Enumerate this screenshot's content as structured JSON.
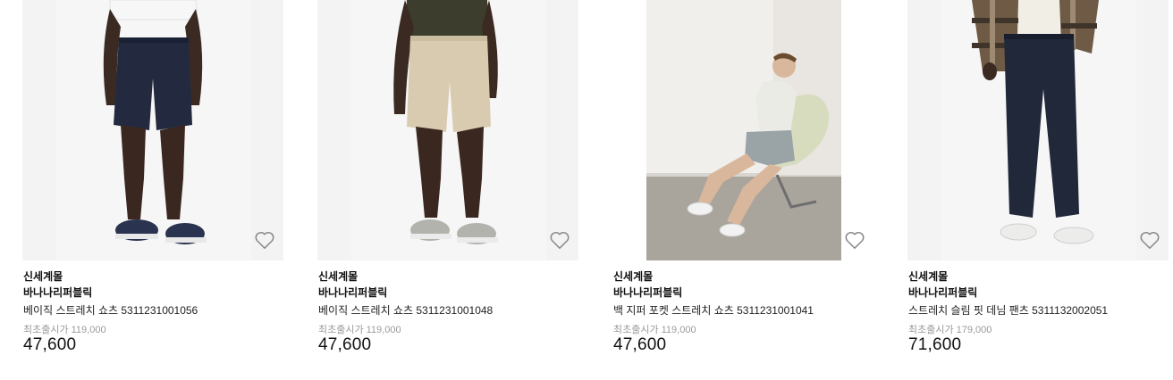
{
  "products": [
    {
      "store": "신세계몰",
      "brand": "바나나리퍼블릭",
      "name": "베이직 스트레치 쇼츠 5311231001056",
      "original_label": "최초출시가",
      "original_price": "119,000",
      "price": "47,600",
      "image": "navy-shorts-photo",
      "wish_icon": "heart-outline-icon"
    },
    {
      "store": "신세계몰",
      "brand": "바나나리퍼블릭",
      "name": "베이직 스트레치 쇼츠 5311231001048",
      "original_label": "최초출시가",
      "original_price": "119,000",
      "price": "47,600",
      "image": "khaki-shorts-photo",
      "wish_icon": "heart-outline-icon"
    },
    {
      "store": "신세계몰",
      "brand": "바나나리퍼블릭",
      "name": "백 지퍼 포켓 스트레치 쇼츠 5311231001041",
      "original_label": "최초출시가",
      "original_price": "119,000",
      "price": "47,600",
      "image": "grey-shorts-seated-model-photo",
      "wish_icon": "heart-outline-icon"
    },
    {
      "store": "신세계몰",
      "brand": "바나나리퍼블릭",
      "name": "스트레치 슬림 핏 데님 팬츠 5311132002051",
      "original_label": "최초출시가",
      "original_price": "179,000",
      "price": "71,600",
      "image": "navy-denim-pants-photo",
      "wish_icon": "heart-outline-icon"
    }
  ],
  "colors": {
    "image_bg": "#f3f3f3",
    "original_price": "#9a9a9a",
    "price": "#111111",
    "heart_stroke": "#8a8a8a"
  }
}
